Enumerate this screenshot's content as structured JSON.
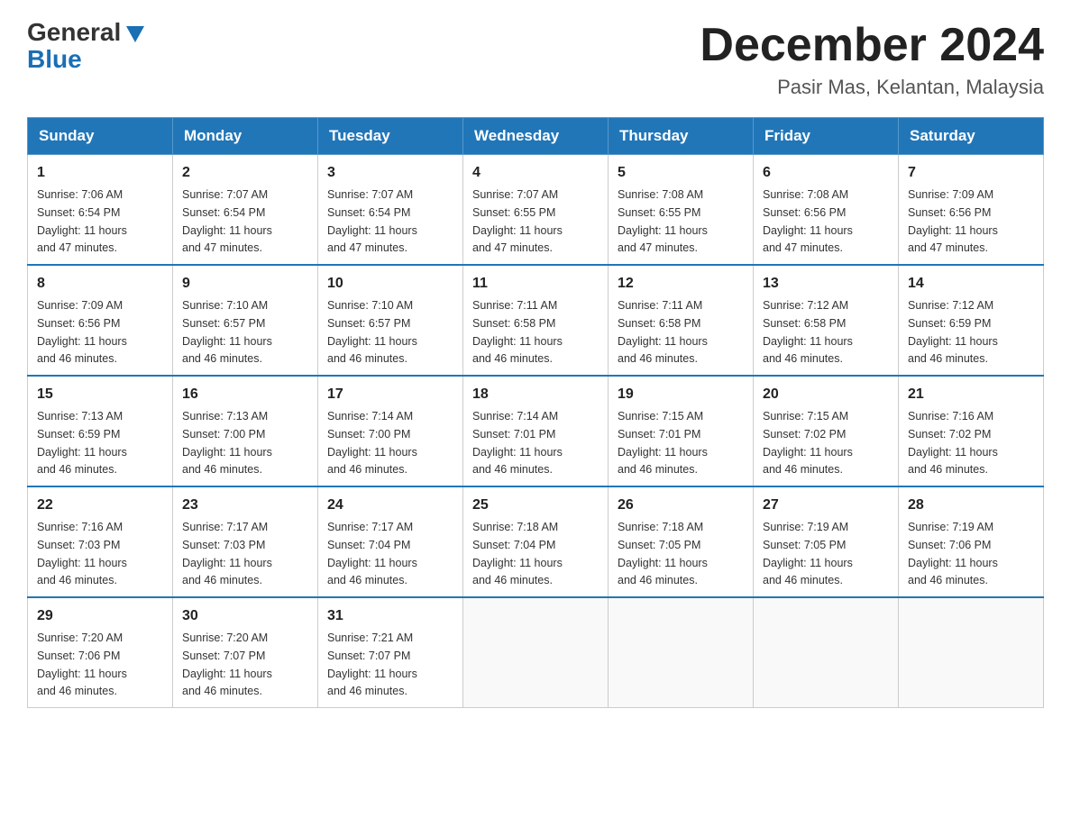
{
  "header": {
    "logo_general": "General",
    "logo_blue": "Blue",
    "month_title": "December 2024",
    "location": "Pasir Mas, Kelantan, Malaysia"
  },
  "days_of_week": [
    "Sunday",
    "Monday",
    "Tuesday",
    "Wednesday",
    "Thursday",
    "Friday",
    "Saturday"
  ],
  "weeks": [
    [
      {
        "day": "1",
        "sunrise": "7:06 AM",
        "sunset": "6:54 PM",
        "daylight": "11 hours and 47 minutes."
      },
      {
        "day": "2",
        "sunrise": "7:07 AM",
        "sunset": "6:54 PM",
        "daylight": "11 hours and 47 minutes."
      },
      {
        "day": "3",
        "sunrise": "7:07 AM",
        "sunset": "6:54 PM",
        "daylight": "11 hours and 47 minutes."
      },
      {
        "day": "4",
        "sunrise": "7:07 AM",
        "sunset": "6:55 PM",
        "daylight": "11 hours and 47 minutes."
      },
      {
        "day": "5",
        "sunrise": "7:08 AM",
        "sunset": "6:55 PM",
        "daylight": "11 hours and 47 minutes."
      },
      {
        "day": "6",
        "sunrise": "7:08 AM",
        "sunset": "6:56 PM",
        "daylight": "11 hours and 47 minutes."
      },
      {
        "day": "7",
        "sunrise": "7:09 AM",
        "sunset": "6:56 PM",
        "daylight": "11 hours and 47 minutes."
      }
    ],
    [
      {
        "day": "8",
        "sunrise": "7:09 AM",
        "sunset": "6:56 PM",
        "daylight": "11 hours and 46 minutes."
      },
      {
        "day": "9",
        "sunrise": "7:10 AM",
        "sunset": "6:57 PM",
        "daylight": "11 hours and 46 minutes."
      },
      {
        "day": "10",
        "sunrise": "7:10 AM",
        "sunset": "6:57 PM",
        "daylight": "11 hours and 46 minutes."
      },
      {
        "day": "11",
        "sunrise": "7:11 AM",
        "sunset": "6:58 PM",
        "daylight": "11 hours and 46 minutes."
      },
      {
        "day": "12",
        "sunrise": "7:11 AM",
        "sunset": "6:58 PM",
        "daylight": "11 hours and 46 minutes."
      },
      {
        "day": "13",
        "sunrise": "7:12 AM",
        "sunset": "6:58 PM",
        "daylight": "11 hours and 46 minutes."
      },
      {
        "day": "14",
        "sunrise": "7:12 AM",
        "sunset": "6:59 PM",
        "daylight": "11 hours and 46 minutes."
      }
    ],
    [
      {
        "day": "15",
        "sunrise": "7:13 AM",
        "sunset": "6:59 PM",
        "daylight": "11 hours and 46 minutes."
      },
      {
        "day": "16",
        "sunrise": "7:13 AM",
        "sunset": "7:00 PM",
        "daylight": "11 hours and 46 minutes."
      },
      {
        "day": "17",
        "sunrise": "7:14 AM",
        "sunset": "7:00 PM",
        "daylight": "11 hours and 46 minutes."
      },
      {
        "day": "18",
        "sunrise": "7:14 AM",
        "sunset": "7:01 PM",
        "daylight": "11 hours and 46 minutes."
      },
      {
        "day": "19",
        "sunrise": "7:15 AM",
        "sunset": "7:01 PM",
        "daylight": "11 hours and 46 minutes."
      },
      {
        "day": "20",
        "sunrise": "7:15 AM",
        "sunset": "7:02 PM",
        "daylight": "11 hours and 46 minutes."
      },
      {
        "day": "21",
        "sunrise": "7:16 AM",
        "sunset": "7:02 PM",
        "daylight": "11 hours and 46 minutes."
      }
    ],
    [
      {
        "day": "22",
        "sunrise": "7:16 AM",
        "sunset": "7:03 PM",
        "daylight": "11 hours and 46 minutes."
      },
      {
        "day": "23",
        "sunrise": "7:17 AM",
        "sunset": "7:03 PM",
        "daylight": "11 hours and 46 minutes."
      },
      {
        "day": "24",
        "sunrise": "7:17 AM",
        "sunset": "7:04 PM",
        "daylight": "11 hours and 46 minutes."
      },
      {
        "day": "25",
        "sunrise": "7:18 AM",
        "sunset": "7:04 PM",
        "daylight": "11 hours and 46 minutes."
      },
      {
        "day": "26",
        "sunrise": "7:18 AM",
        "sunset": "7:05 PM",
        "daylight": "11 hours and 46 minutes."
      },
      {
        "day": "27",
        "sunrise": "7:19 AM",
        "sunset": "7:05 PM",
        "daylight": "11 hours and 46 minutes."
      },
      {
        "day": "28",
        "sunrise": "7:19 AM",
        "sunset": "7:06 PM",
        "daylight": "11 hours and 46 minutes."
      }
    ],
    [
      {
        "day": "29",
        "sunrise": "7:20 AM",
        "sunset": "7:06 PM",
        "daylight": "11 hours and 46 minutes."
      },
      {
        "day": "30",
        "sunrise": "7:20 AM",
        "sunset": "7:07 PM",
        "daylight": "11 hours and 46 minutes."
      },
      {
        "day": "31",
        "sunrise": "7:21 AM",
        "sunset": "7:07 PM",
        "daylight": "11 hours and 46 minutes."
      },
      null,
      null,
      null,
      null
    ]
  ],
  "labels": {
    "sunrise": "Sunrise:",
    "sunset": "Sunset:",
    "daylight": "Daylight:"
  }
}
